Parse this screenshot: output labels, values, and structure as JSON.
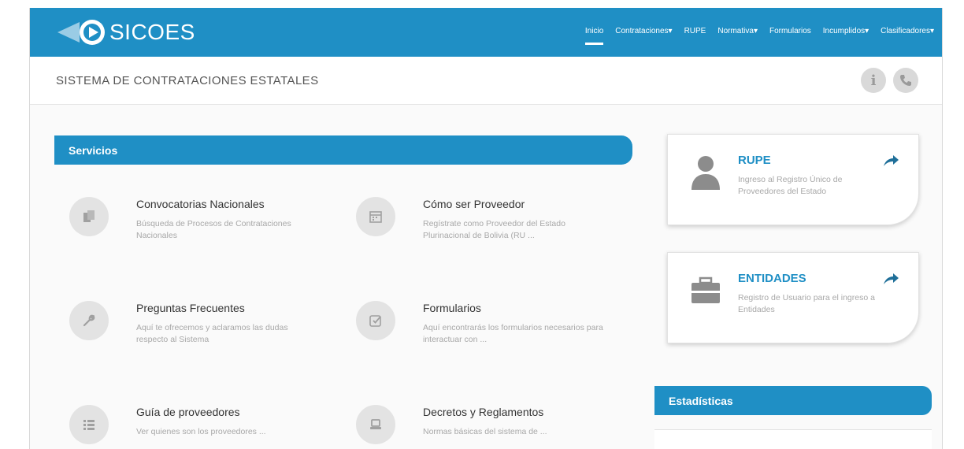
{
  "brand": {
    "name": "SICOES",
    "primary_color": "#1f8fc5"
  },
  "nav": {
    "items": [
      {
        "label": "Inicio",
        "active": true
      },
      {
        "label": "Contrataciones",
        "dropdown": true
      },
      {
        "label": "RUPE"
      },
      {
        "label": "Normativa",
        "dropdown": true
      },
      {
        "label": "Formularios"
      },
      {
        "label": "Incumplidos",
        "dropdown": true
      },
      {
        "label": "Clasificadores",
        "dropdown": true
      }
    ]
  },
  "subheader": {
    "title": "SISTEMA DE CONTRATACIONES ESTATALES",
    "info_icon": "info-icon",
    "phone_icon": "phone-icon"
  },
  "services": {
    "title": "Servicios",
    "items": [
      {
        "title": "Convocatorias Nacionales",
        "desc": "Búsqueda de Procesos de Contrataciones Nacionales",
        "icon": "documents-icon"
      },
      {
        "title": "Cómo ser Proveedor",
        "desc": "Regístrate como Proveedor del Estado Plurinacional de Bolivia (RU ...",
        "icon": "calendar-icon"
      },
      {
        "title": "Preguntas Frecuentes",
        "desc": "Aquí te ofrecemos y aclaramos las dudas respecto al Sistema",
        "icon": "wrench-icon"
      },
      {
        "title": "Formularios",
        "desc": "Aquí encontrarás los formularios necesarios para interactuar con ...",
        "icon": "form-check-icon"
      },
      {
        "title": "Guía de proveedores",
        "desc": "Ver quienes son los proveedores ...",
        "icon": "list-icon"
      },
      {
        "title": "Decretos y Reglamentos",
        "desc": "Normas básicas del sistema de ...",
        "icon": "laptop-icon"
      }
    ]
  },
  "cards": [
    {
      "title": "RUPE",
      "desc": "Ingreso al Registro Único de Proveedores del Estado",
      "icon": "user-icon"
    },
    {
      "title": "ENTIDADES",
      "desc": "Registro de Usuario para el ingreso a Entidades",
      "icon": "briefcase-icon"
    }
  ],
  "stats": {
    "title": "Estadísticas"
  }
}
